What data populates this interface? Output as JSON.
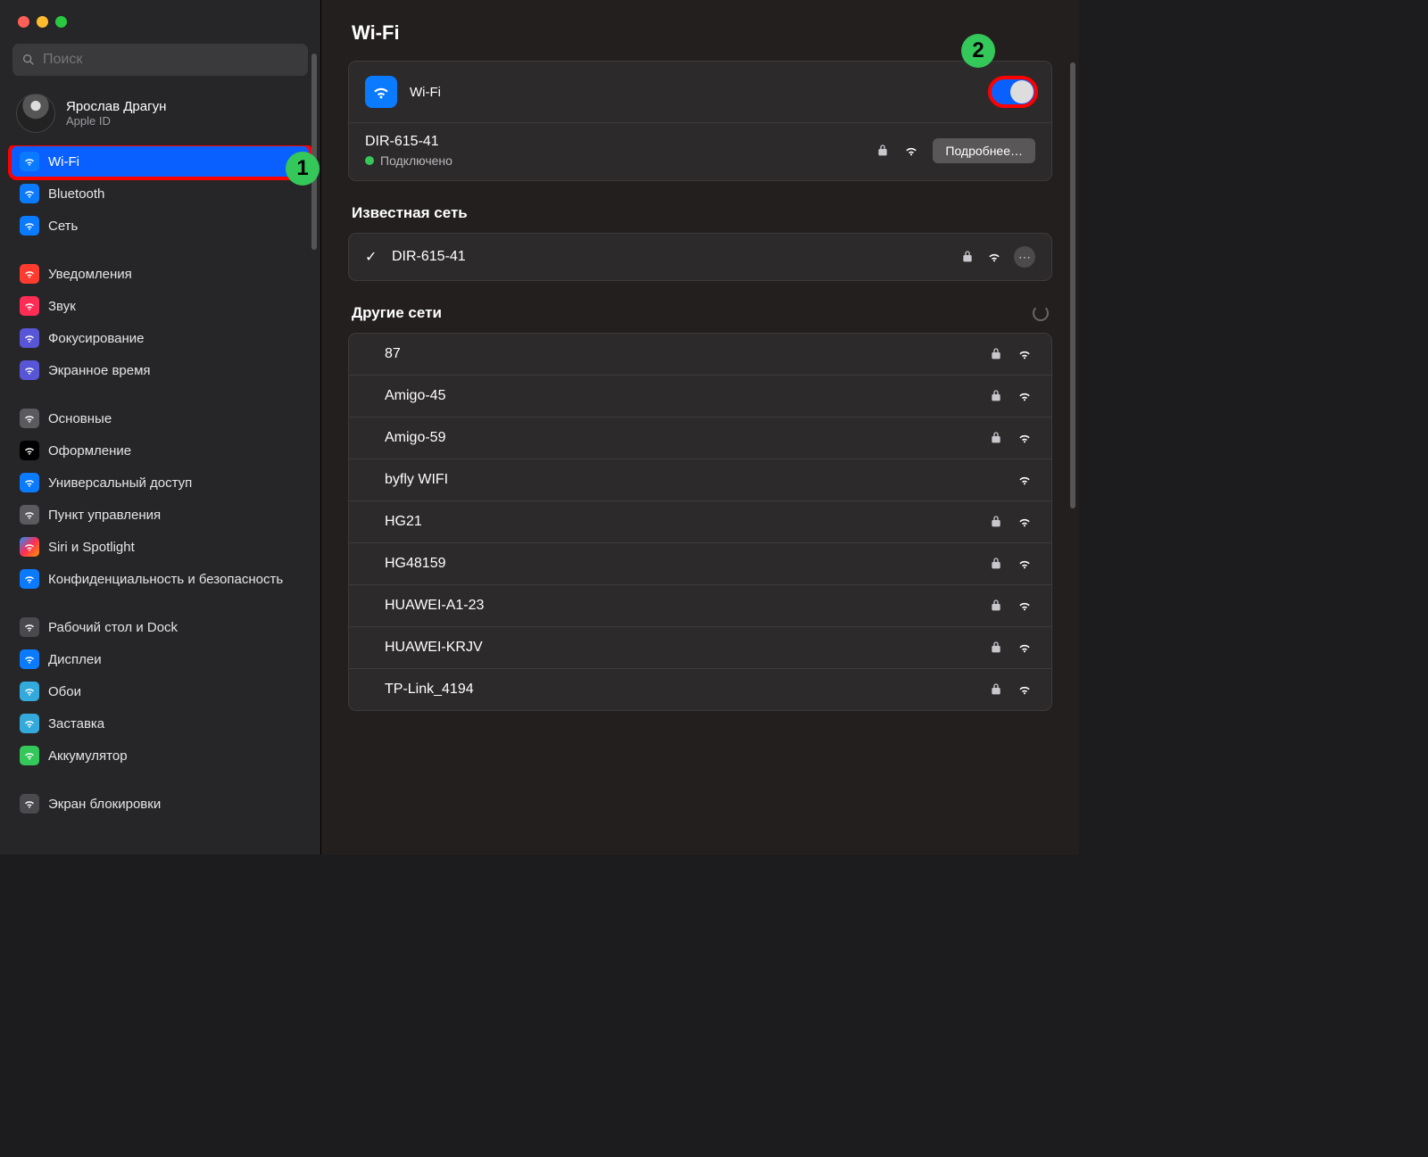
{
  "search_placeholder": "Поиск",
  "user": {
    "name": "Ярослав Драгун",
    "sub": "Apple ID"
  },
  "sidebar": {
    "groups": [
      [
        {
          "label": "Wi-Fi",
          "icon": "ic-wifi",
          "sel": true
        },
        {
          "label": "Bluetooth",
          "icon": "ic-bt"
        },
        {
          "label": "Сеть",
          "icon": "ic-net"
        }
      ],
      [
        {
          "label": "Уведомления",
          "icon": "ic-notif"
        },
        {
          "label": "Звук",
          "icon": "ic-sound"
        },
        {
          "label": "Фокусирование",
          "icon": "ic-focus"
        },
        {
          "label": "Экранное время",
          "icon": "ic-screentime"
        }
      ],
      [
        {
          "label": "Основные",
          "icon": "ic-general"
        },
        {
          "label": "Оформление",
          "icon": "ic-appearance"
        },
        {
          "label": "Универсальный доступ",
          "icon": "ic-access"
        },
        {
          "label": "Пункт управления",
          "icon": "ic-control"
        },
        {
          "label": "Siri и Spotlight",
          "icon": "ic-siri"
        },
        {
          "label": "Конфиденциальность и безопасность",
          "icon": "ic-privacy"
        }
      ],
      [
        {
          "label": "Рабочий стол и Dock",
          "icon": "ic-desktop"
        },
        {
          "label": "Дисплеи",
          "icon": "ic-display"
        },
        {
          "label": "Обои",
          "icon": "ic-wallpaper"
        },
        {
          "label": "Заставка",
          "icon": "ic-screensaver"
        },
        {
          "label": "Аккумулятор",
          "icon": "ic-battery"
        }
      ],
      [
        {
          "label": "Экран блокировки",
          "icon": "ic-lock"
        }
      ]
    ]
  },
  "main": {
    "title": "Wi-Fi",
    "wifi_label": "Wi-Fi",
    "current": {
      "name": "DIR-615-41",
      "status": "Подключено",
      "details_btn": "Подробнее…"
    },
    "known_title": "Известная сеть",
    "known": [
      {
        "name": "DIR-615-41",
        "locked": true
      }
    ],
    "other_title": "Другие сети",
    "other": [
      {
        "name": "87",
        "locked": true
      },
      {
        "name": "Amigo-45",
        "locked": true
      },
      {
        "name": "Amigo-59",
        "locked": true
      },
      {
        "name": "byfly WIFI",
        "locked": false
      },
      {
        "name": "HG21",
        "locked": true
      },
      {
        "name": "HG48159",
        "locked": true
      },
      {
        "name": "HUAWEI-A1-23",
        "locked": true
      },
      {
        "name": "HUAWEI-KRJV",
        "locked": true
      },
      {
        "name": "TP-Link_4194",
        "locked": true
      }
    ]
  },
  "annotations": {
    "badge1": "1",
    "badge2": "2"
  }
}
